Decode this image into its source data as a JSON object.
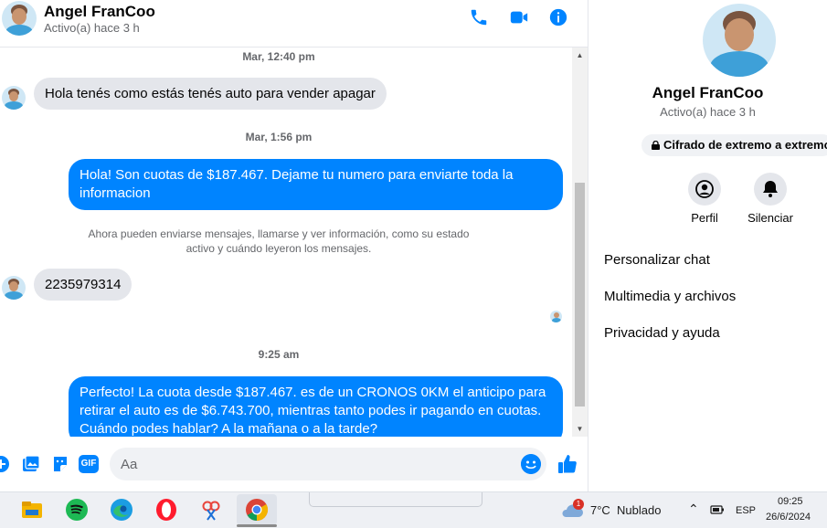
{
  "header": {
    "name": "Angel FranCoo",
    "status": "Activo(a) hace 3 h",
    "icons": [
      "phone-icon",
      "video-icon",
      "info-icon"
    ]
  },
  "messages": {
    "ts1": "Mar, 12:40 pm",
    "in1": "Hola tenés como estás tenés auto para vender apagar",
    "ts2": "Mar, 1:56 pm",
    "out1": "Hola! Son cuotas de $187.467. Dejame tu numero para enviarte toda la informacion",
    "system": "Ahora pueden enviarse mensajes, llamarse y ver información, como su estado activo y cuándo leyeron los mensajes.",
    "in2": "2235979314",
    "ts3": "9:25 am",
    "out2": "Perfecto! La cuota desde $187.467. es de un CRONOS 0KM el anticipo para retirar el auto es de $6.743.700, mientras tanto podes ir pagando en cuotas. Cuándo podes hablar? A la mañana o a la tarde?"
  },
  "composer": {
    "placeholder": "Aa",
    "gif_label": "GIF"
  },
  "panel": {
    "name": "Angel FranCoo",
    "status": "Activo(a) hace 3 h",
    "encryption": "Cifrado de extremo a extremo",
    "actions": [
      {
        "label": "Perfil",
        "icon": "profile-icon"
      },
      {
        "label": "Silenciar",
        "icon": "bell-icon"
      }
    ],
    "menu": [
      "Personalizar chat",
      "Multimedia y archivos",
      "Privacidad y ayuda"
    ]
  },
  "taskbar": {
    "apps": [
      "file-explorer-icon",
      "spotify-icon",
      "edge-icon",
      "opera-icon",
      "snipping-tool-icon",
      "chrome-icon"
    ],
    "weather": "7°C  Nublado",
    "weather_badge": "1",
    "lang": "ESP",
    "time": "09:25",
    "date": "26/6/2024"
  },
  "colors": {
    "messenger_blue": "#0084ff",
    "incoming_bubble": "#e4e6eb",
    "muted_text": "#65676b"
  }
}
